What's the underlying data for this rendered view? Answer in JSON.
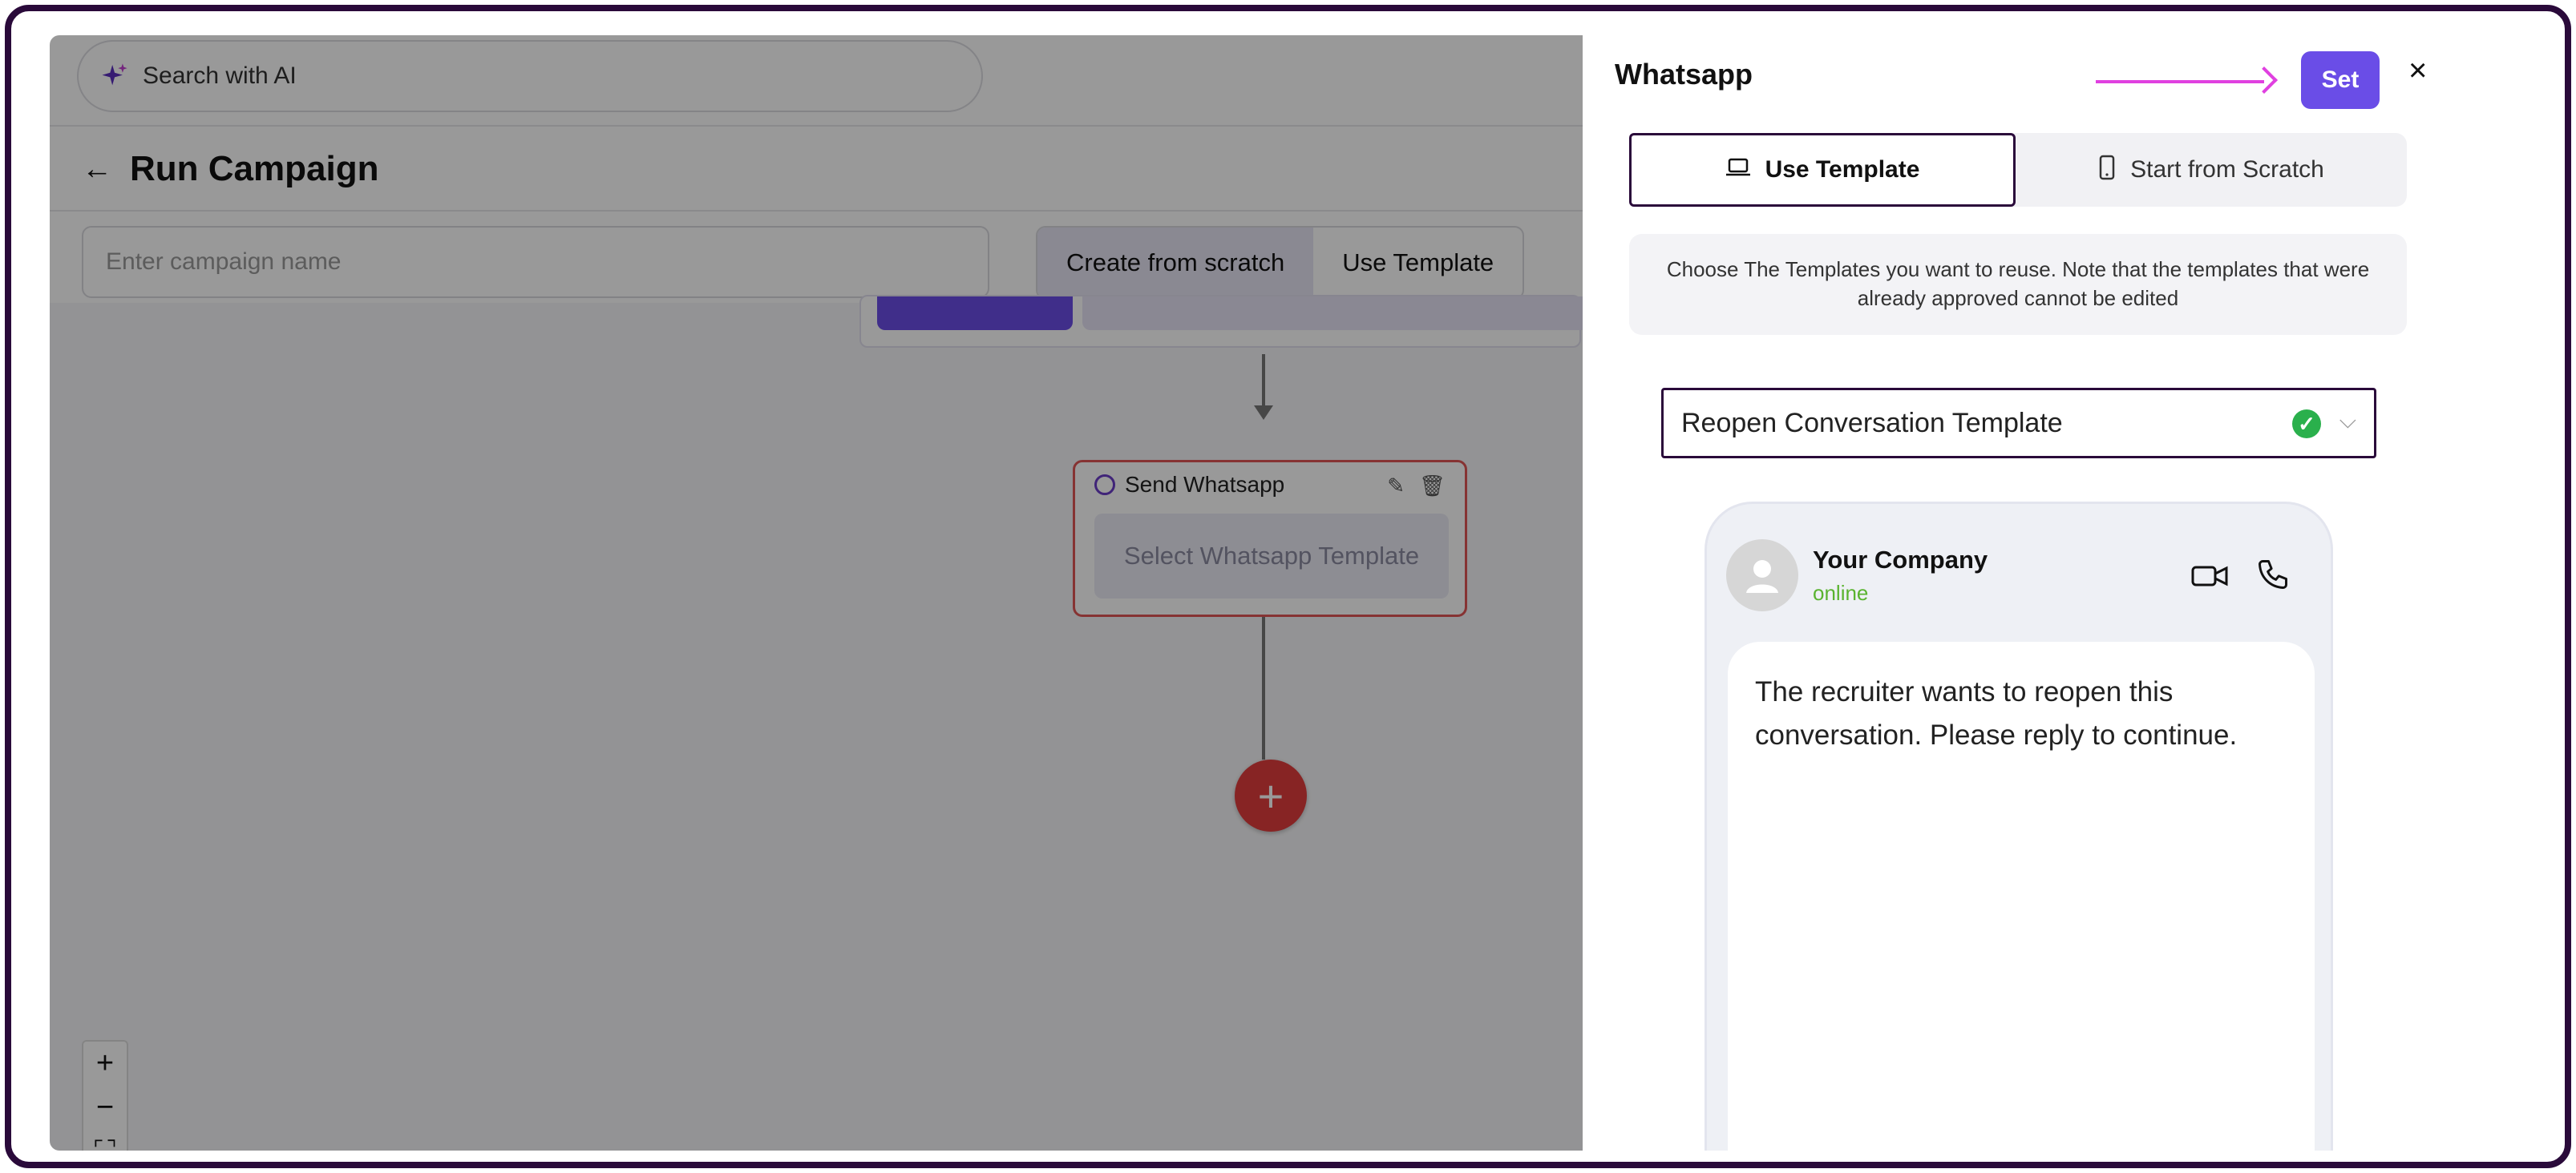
{
  "topbar": {
    "search_label": "Search with AI",
    "search_icon": "sparkle-icon"
  },
  "page": {
    "title": "Run Campaign",
    "back_icon": "arrow-left-icon"
  },
  "campaign": {
    "name_placeholder": "Enter campaign name",
    "modes": [
      {
        "label": "Create from scratch",
        "active": true
      },
      {
        "label": "Use Template",
        "active": false
      }
    ]
  },
  "flow": {
    "node": {
      "title": "Send Whatsapp",
      "placeholder": "Select Whatsapp Template",
      "edit_icon": "pencil-icon",
      "delete_icon": "trash-icon"
    },
    "add_icon": "+"
  },
  "zoom": {
    "in": "+",
    "out": "−",
    "fit": "⛶"
  },
  "panel": {
    "title": "Whatsapp",
    "set_label": "Set",
    "close_label": "×",
    "tabs": [
      {
        "label": "Use Template",
        "icon": "laptop-icon",
        "active": true
      },
      {
        "label": "Start from Scratch",
        "icon": "phone-icon",
        "active": false
      }
    ],
    "note": "Choose The Templates you want to reuse. Note that the templates that were already approved cannot be edited",
    "template_select": {
      "value": "Reopen Conversation Template",
      "status_icon": "check-circle-icon"
    },
    "preview": {
      "company": "Your Company",
      "status": "online",
      "message": "The recruiter wants to reopen this conversation. Please reply to continue."
    }
  },
  "colors": {
    "accent": "#6a4de7",
    "annotation_arrow": "#e040e0",
    "online": "#5ab330",
    "add_button": "#e23d3d"
  }
}
